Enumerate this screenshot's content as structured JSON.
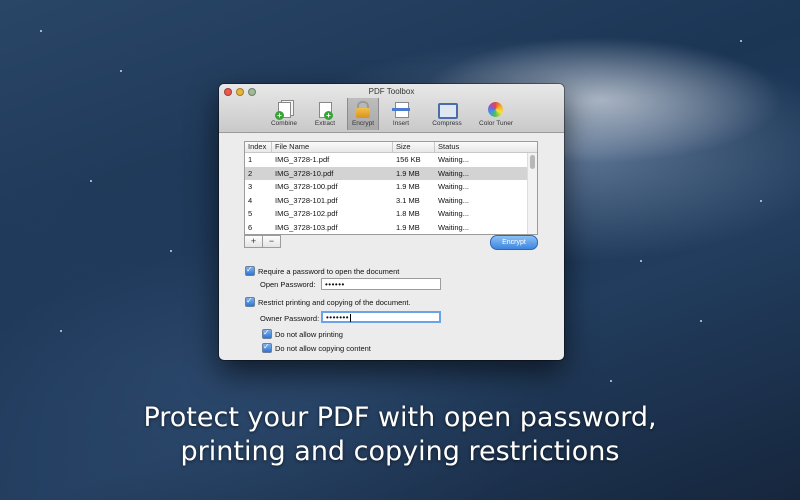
{
  "window": {
    "title": "PDF Toolbox"
  },
  "toolbar": {
    "items": [
      {
        "label": "Combine",
        "icon": "combine-icon"
      },
      {
        "label": "Extract",
        "icon": "extract-icon"
      },
      {
        "label": "Encrypt",
        "icon": "lock-icon",
        "active": true
      },
      {
        "label": "Insert",
        "icon": "insert-icon"
      },
      {
        "label": "Compress",
        "icon": "compress-icon"
      },
      {
        "label": "Color Tuner",
        "icon": "color-wheel-icon"
      }
    ]
  },
  "file_table": {
    "columns": [
      "Index",
      "File Name",
      "Size",
      "Status"
    ],
    "rows": [
      {
        "index": "1",
        "name": "IMG_3728-1.pdf",
        "size": "156 KB",
        "status": "Waiting..."
      },
      {
        "index": "2",
        "name": "IMG_3728-10.pdf",
        "size": "1.9 MB",
        "status": "Waiting...",
        "selected": true
      },
      {
        "index": "3",
        "name": "IMG_3728-100.pdf",
        "size": "1.9 MB",
        "status": "Waiting..."
      },
      {
        "index": "4",
        "name": "IMG_3728-101.pdf",
        "size": "3.1 MB",
        "status": "Waiting..."
      },
      {
        "index": "5",
        "name": "IMG_3728-102.pdf",
        "size": "1.8 MB",
        "status": "Waiting..."
      },
      {
        "index": "6",
        "name": "IMG_3728-103.pdf",
        "size": "1.9 MB",
        "status": "Waiting..."
      }
    ]
  },
  "controls": {
    "add_label": "+",
    "remove_label": "−",
    "encrypt_label": "Encrypt"
  },
  "options": {
    "require_open_password": {
      "label": "Require a password to open the document",
      "checked": true
    },
    "open_password_label": "Open Password:",
    "open_password_value": "••••••",
    "restrict": {
      "label": "Restrict printing and copying of the document.",
      "checked": true
    },
    "owner_password_label": "Owner Password:",
    "owner_password_value": "•••••••",
    "no_printing": {
      "label": "Do not allow printing",
      "checked": true
    },
    "no_copying": {
      "label": "Do not allow copying content",
      "checked": true
    }
  },
  "caption": {
    "line1": "Protect your PDF with open password,",
    "line2": "printing and copying restrictions"
  },
  "colors": {
    "accent": "#3d86e0",
    "selection": "#d3d3d3"
  }
}
